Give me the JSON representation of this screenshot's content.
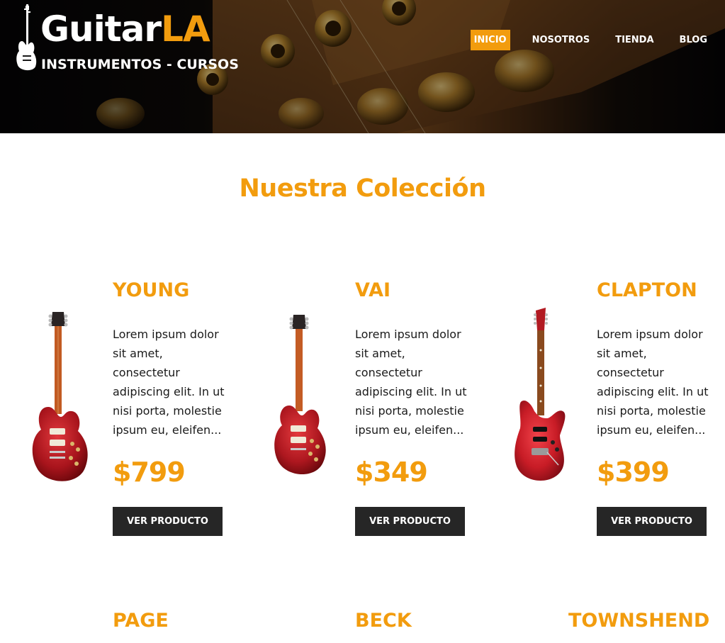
{
  "header": {
    "logo": {
      "text_main": "Guitar",
      "text_accent": "LA",
      "subtitle": "INSTRUMENTOS - CURSOS"
    },
    "nav": [
      {
        "label": "INICIO",
        "active": true
      },
      {
        "label": "NOSOTROS",
        "active": false
      },
      {
        "label": "TIENDA",
        "active": false
      },
      {
        "label": "BLOG",
        "active": false
      }
    ]
  },
  "main": {
    "title": "Nuestra Colección",
    "products": [
      {
        "name": "YOUNG",
        "description": "Lorem ipsum dolor sit amet, consectetur adipiscing elit. In ut nisi porta, molestie ipsum eu, eleifen...",
        "price": "$799",
        "button_label": "VER PRODUCTO",
        "image_icon": "les-paul-guitar-icon"
      },
      {
        "name": "VAI",
        "description": "Lorem ipsum dolor sit amet, consectetur adipiscing elit. In ut nisi porta, molestie ipsum eu, eleifen...",
        "price": "$349",
        "button_label": "VER PRODUCTO",
        "image_icon": "les-paul-guitar-icon"
      },
      {
        "name": "CLAPTON",
        "description": "Lorem ipsum dolor sit amet, consectetur adipiscing elit. In ut nisi porta, molestie ipsum eu, eleifen...",
        "price": "$399",
        "button_label": "VER PRODUCTO",
        "image_icon": "superstrat-guitar-icon"
      }
    ],
    "next_row_names": [
      "PAGE",
      "BECK",
      "TOWNSHEND"
    ]
  },
  "colors": {
    "accent": "#f29c0e",
    "button_bg": "#262626",
    "text": "#1a1a1a"
  }
}
